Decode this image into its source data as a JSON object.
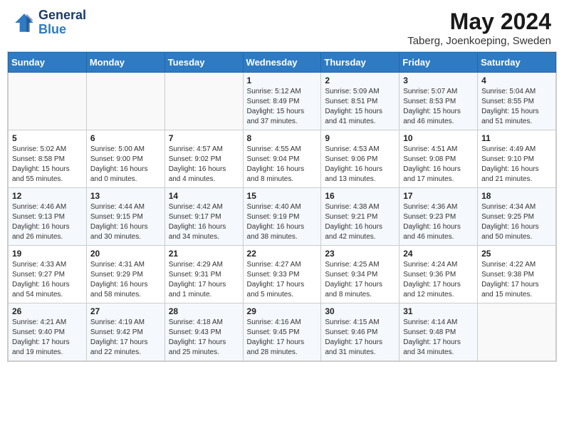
{
  "header": {
    "logo_line1": "General",
    "logo_line2": "Blue",
    "title": "May 2024",
    "subtitle": "Taberg, Joenkoeping, Sweden"
  },
  "weekdays": [
    "Sunday",
    "Monday",
    "Tuesday",
    "Wednesday",
    "Thursday",
    "Friday",
    "Saturday"
  ],
  "weeks": [
    [
      {
        "day": "",
        "info": ""
      },
      {
        "day": "",
        "info": ""
      },
      {
        "day": "",
        "info": ""
      },
      {
        "day": "1",
        "info": "Sunrise: 5:12 AM\nSunset: 8:49 PM\nDaylight: 15 hours\nand 37 minutes."
      },
      {
        "day": "2",
        "info": "Sunrise: 5:09 AM\nSunset: 8:51 PM\nDaylight: 15 hours\nand 41 minutes."
      },
      {
        "day": "3",
        "info": "Sunrise: 5:07 AM\nSunset: 8:53 PM\nDaylight: 15 hours\nand 46 minutes."
      },
      {
        "day": "4",
        "info": "Sunrise: 5:04 AM\nSunset: 8:55 PM\nDaylight: 15 hours\nand 51 minutes."
      }
    ],
    [
      {
        "day": "5",
        "info": "Sunrise: 5:02 AM\nSunset: 8:58 PM\nDaylight: 15 hours\nand 55 minutes."
      },
      {
        "day": "6",
        "info": "Sunrise: 5:00 AM\nSunset: 9:00 PM\nDaylight: 16 hours\nand 0 minutes."
      },
      {
        "day": "7",
        "info": "Sunrise: 4:57 AM\nSunset: 9:02 PM\nDaylight: 16 hours\nand 4 minutes."
      },
      {
        "day": "8",
        "info": "Sunrise: 4:55 AM\nSunset: 9:04 PM\nDaylight: 16 hours\nand 8 minutes."
      },
      {
        "day": "9",
        "info": "Sunrise: 4:53 AM\nSunset: 9:06 PM\nDaylight: 16 hours\nand 13 minutes."
      },
      {
        "day": "10",
        "info": "Sunrise: 4:51 AM\nSunset: 9:08 PM\nDaylight: 16 hours\nand 17 minutes."
      },
      {
        "day": "11",
        "info": "Sunrise: 4:49 AM\nSunset: 9:10 PM\nDaylight: 16 hours\nand 21 minutes."
      }
    ],
    [
      {
        "day": "12",
        "info": "Sunrise: 4:46 AM\nSunset: 9:13 PM\nDaylight: 16 hours\nand 26 minutes."
      },
      {
        "day": "13",
        "info": "Sunrise: 4:44 AM\nSunset: 9:15 PM\nDaylight: 16 hours\nand 30 minutes."
      },
      {
        "day": "14",
        "info": "Sunrise: 4:42 AM\nSunset: 9:17 PM\nDaylight: 16 hours\nand 34 minutes."
      },
      {
        "day": "15",
        "info": "Sunrise: 4:40 AM\nSunset: 9:19 PM\nDaylight: 16 hours\nand 38 minutes."
      },
      {
        "day": "16",
        "info": "Sunrise: 4:38 AM\nSunset: 9:21 PM\nDaylight: 16 hours\nand 42 minutes."
      },
      {
        "day": "17",
        "info": "Sunrise: 4:36 AM\nSunset: 9:23 PM\nDaylight: 16 hours\nand 46 minutes."
      },
      {
        "day": "18",
        "info": "Sunrise: 4:34 AM\nSunset: 9:25 PM\nDaylight: 16 hours\nand 50 minutes."
      }
    ],
    [
      {
        "day": "19",
        "info": "Sunrise: 4:33 AM\nSunset: 9:27 PM\nDaylight: 16 hours\nand 54 minutes."
      },
      {
        "day": "20",
        "info": "Sunrise: 4:31 AM\nSunset: 9:29 PM\nDaylight: 16 hours\nand 58 minutes."
      },
      {
        "day": "21",
        "info": "Sunrise: 4:29 AM\nSunset: 9:31 PM\nDaylight: 17 hours\nand 1 minute."
      },
      {
        "day": "22",
        "info": "Sunrise: 4:27 AM\nSunset: 9:33 PM\nDaylight: 17 hours\nand 5 minutes."
      },
      {
        "day": "23",
        "info": "Sunrise: 4:25 AM\nSunset: 9:34 PM\nDaylight: 17 hours\nand 8 minutes."
      },
      {
        "day": "24",
        "info": "Sunrise: 4:24 AM\nSunset: 9:36 PM\nDaylight: 17 hours\nand 12 minutes."
      },
      {
        "day": "25",
        "info": "Sunrise: 4:22 AM\nSunset: 9:38 PM\nDaylight: 17 hours\nand 15 minutes."
      }
    ],
    [
      {
        "day": "26",
        "info": "Sunrise: 4:21 AM\nSunset: 9:40 PM\nDaylight: 17 hours\nand 19 minutes."
      },
      {
        "day": "27",
        "info": "Sunrise: 4:19 AM\nSunset: 9:42 PM\nDaylight: 17 hours\nand 22 minutes."
      },
      {
        "day": "28",
        "info": "Sunrise: 4:18 AM\nSunset: 9:43 PM\nDaylight: 17 hours\nand 25 minutes."
      },
      {
        "day": "29",
        "info": "Sunrise: 4:16 AM\nSunset: 9:45 PM\nDaylight: 17 hours\nand 28 minutes."
      },
      {
        "day": "30",
        "info": "Sunrise: 4:15 AM\nSunset: 9:46 PM\nDaylight: 17 hours\nand 31 minutes."
      },
      {
        "day": "31",
        "info": "Sunrise: 4:14 AM\nSunset: 9:48 PM\nDaylight: 17 hours\nand 34 minutes."
      },
      {
        "day": "",
        "info": ""
      }
    ]
  ]
}
